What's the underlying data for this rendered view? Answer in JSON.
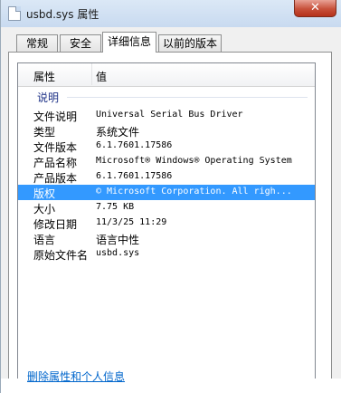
{
  "window": {
    "title": "usbd.sys 属性",
    "close_label": "✕"
  },
  "tabs": [
    {
      "label": "常规",
      "active": false
    },
    {
      "label": "安全",
      "active": false
    },
    {
      "label": "详细信息",
      "active": true
    },
    {
      "label": "以前的版本",
      "active": false
    }
  ],
  "details": {
    "headers": {
      "property": "属性",
      "value": "值"
    },
    "group": "说明",
    "rows": [
      {
        "property": "文件说明",
        "value": "Universal Serial Bus Driver",
        "selected": false
      },
      {
        "property": "类型",
        "value": "系统文件",
        "selected": false
      },
      {
        "property": "文件版本",
        "value": "6.1.7601.17586",
        "selected": false
      },
      {
        "property": "产品名称",
        "value": "Microsoft® Windows® Operating System",
        "selected": false
      },
      {
        "property": "产品版本",
        "value": "6.1.7601.17586",
        "selected": false
      },
      {
        "property": "版权",
        "value": "© Microsoft Corporation. All righ...",
        "selected": true
      },
      {
        "property": "大小",
        "value": "7.75 KB",
        "selected": false
      },
      {
        "property": "修改日期",
        "value": "11/3/25 11:29",
        "selected": false
      },
      {
        "property": "语言",
        "value": "语言中性",
        "selected": false
      },
      {
        "property": "原始文件名",
        "value": "usbd.sys",
        "selected": false
      }
    ]
  },
  "link": {
    "remove_label": "删除属性和个人信息"
  },
  "colors": {
    "selection": "#3399ff",
    "link": "#0066cc",
    "group": "#1e3287"
  }
}
